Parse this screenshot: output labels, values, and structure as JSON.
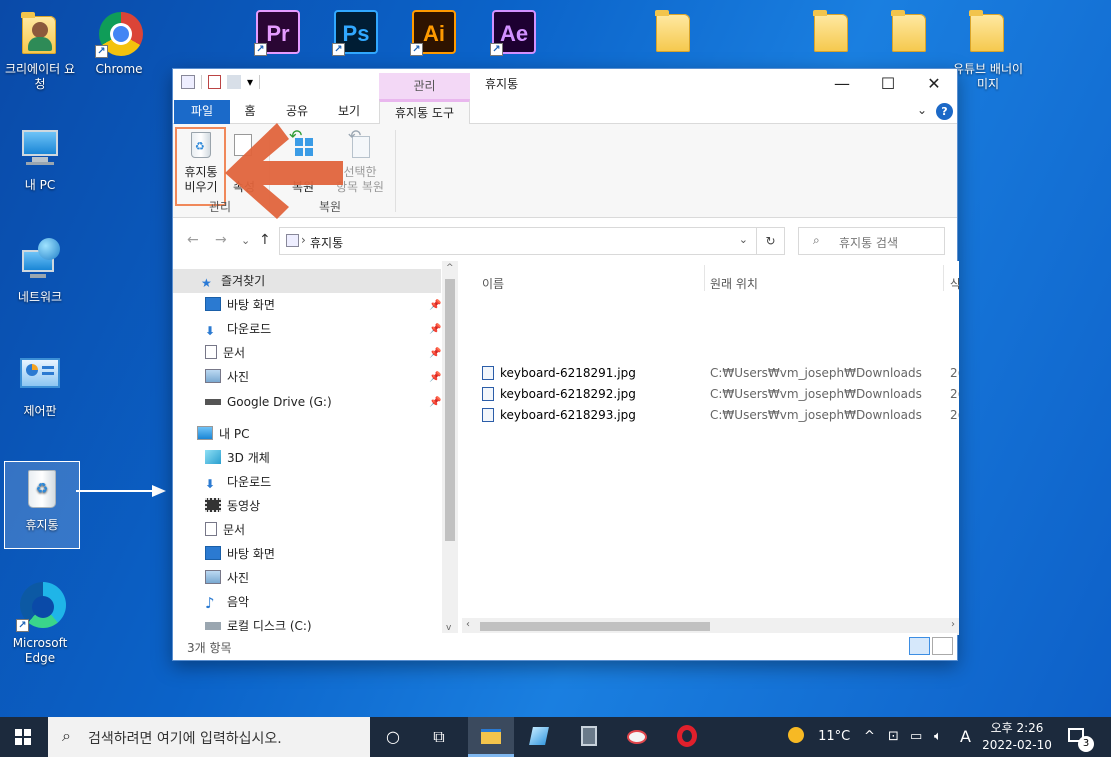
{
  "desktop_icons": [
    {
      "id": "creator",
      "label": "크리에이터 요청",
      "type": "folder-person"
    },
    {
      "id": "chrome",
      "label": "Chrome",
      "type": "chrome"
    },
    {
      "id": "mypc",
      "label": "내 PC",
      "type": "pc"
    },
    {
      "id": "network",
      "label": "네트워크",
      "type": "network"
    },
    {
      "id": "control",
      "label": "제어판",
      "type": "control-panel"
    },
    {
      "id": "recycle",
      "label": "휴지통",
      "type": "recycle-bin"
    },
    {
      "id": "edge",
      "label": "Microsoft Edge",
      "type": "edge"
    },
    {
      "id": "youtube",
      "label": "유튜브 배너이미지",
      "type": "folder"
    }
  ],
  "adobe_icons": [
    {
      "id": "pr",
      "text": "Pr",
      "bg": "#2a0634",
      "fg": "#e59cff"
    },
    {
      "id": "ps",
      "text": "Ps",
      "bg": "#001d34",
      "fg": "#31a8ff"
    },
    {
      "id": "ai",
      "text": "Ai",
      "bg": "#2e1300",
      "fg": "#ff9a00"
    },
    {
      "id": "ae",
      "text": "Ae",
      "bg": "#1d0031",
      "fg": "#d291ff"
    }
  ],
  "window": {
    "title": "휴지통",
    "context_tab_header": "관리",
    "tabs": [
      "파일",
      "홈",
      "공유",
      "보기",
      "휴지통 도구"
    ],
    "ribbon": {
      "empty_bin_line1": "휴지통",
      "empty_bin_line2": "비우기",
      "properties_label": "속성",
      "restore_all_label": "복원",
      "restore_selected_line1": "선택한",
      "restore_selected_line2": "항목 복원",
      "group_manage": "관리",
      "group_restore": "복원"
    },
    "address": {
      "path": "휴지통",
      "search_placeholder": "휴지통 검색"
    },
    "nav": {
      "favorites": "즐겨찾기",
      "fav_items": [
        "바탕 화면",
        "다운로드",
        "문서",
        "사진",
        "Google Drive (G:)"
      ],
      "this_pc": "내 PC",
      "pc_items": [
        "3D 개체",
        "다운로드",
        "동영상",
        "문서",
        "바탕 화면",
        "사진",
        "음악",
        "로컬 디스크 (C:)"
      ]
    },
    "columns": {
      "name": "이름",
      "original_location": "원래 위치",
      "trunc": "삭"
    },
    "files": [
      {
        "name": "keyboard-6218291.jpg",
        "location": "C:₩Users₩vm_joseph₩Downloads",
        "trunc": "2("
      },
      {
        "name": "keyboard-6218292.jpg",
        "location": "C:₩Users₩vm_joseph₩Downloads",
        "trunc": "2("
      },
      {
        "name": "keyboard-6218293.jpg",
        "location": "C:₩Users₩vm_joseph₩Downloads",
        "trunc": "2("
      }
    ],
    "status": "3개 항목"
  },
  "taskbar": {
    "search_placeholder": "검색하려면 여기에 입력하십시오.",
    "weather": "11°C",
    "ime": "A",
    "clock_time": "오후 2:26",
    "clock_date": "2022-02-10",
    "notification_count": "3"
  },
  "colors": {
    "accent": "#1b6ac9",
    "arrow": "#e0643c",
    "desktop": "#0b63c9"
  }
}
